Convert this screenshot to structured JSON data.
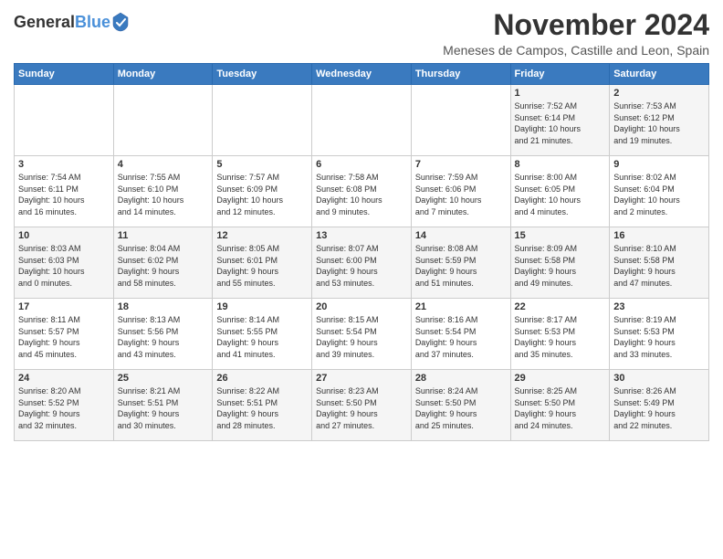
{
  "header": {
    "logo_line1": "General",
    "logo_line2": "Blue",
    "month": "November 2024",
    "location": "Meneses de Campos, Castille and Leon, Spain"
  },
  "weekdays": [
    "Sunday",
    "Monday",
    "Tuesday",
    "Wednesday",
    "Thursday",
    "Friday",
    "Saturday"
  ],
  "weeks": [
    [
      {
        "day": "",
        "info": ""
      },
      {
        "day": "",
        "info": ""
      },
      {
        "day": "",
        "info": ""
      },
      {
        "day": "",
        "info": ""
      },
      {
        "day": "",
        "info": ""
      },
      {
        "day": "1",
        "info": "Sunrise: 7:52 AM\nSunset: 6:14 PM\nDaylight: 10 hours\nand 21 minutes."
      },
      {
        "day": "2",
        "info": "Sunrise: 7:53 AM\nSunset: 6:12 PM\nDaylight: 10 hours\nand 19 minutes."
      }
    ],
    [
      {
        "day": "3",
        "info": "Sunrise: 7:54 AM\nSunset: 6:11 PM\nDaylight: 10 hours\nand 16 minutes."
      },
      {
        "day": "4",
        "info": "Sunrise: 7:55 AM\nSunset: 6:10 PM\nDaylight: 10 hours\nand 14 minutes."
      },
      {
        "day": "5",
        "info": "Sunrise: 7:57 AM\nSunset: 6:09 PM\nDaylight: 10 hours\nand 12 minutes."
      },
      {
        "day": "6",
        "info": "Sunrise: 7:58 AM\nSunset: 6:08 PM\nDaylight: 10 hours\nand 9 minutes."
      },
      {
        "day": "7",
        "info": "Sunrise: 7:59 AM\nSunset: 6:06 PM\nDaylight: 10 hours\nand 7 minutes."
      },
      {
        "day": "8",
        "info": "Sunrise: 8:00 AM\nSunset: 6:05 PM\nDaylight: 10 hours\nand 4 minutes."
      },
      {
        "day": "9",
        "info": "Sunrise: 8:02 AM\nSunset: 6:04 PM\nDaylight: 10 hours\nand 2 minutes."
      }
    ],
    [
      {
        "day": "10",
        "info": "Sunrise: 8:03 AM\nSunset: 6:03 PM\nDaylight: 10 hours\nand 0 minutes."
      },
      {
        "day": "11",
        "info": "Sunrise: 8:04 AM\nSunset: 6:02 PM\nDaylight: 9 hours\nand 58 minutes."
      },
      {
        "day": "12",
        "info": "Sunrise: 8:05 AM\nSunset: 6:01 PM\nDaylight: 9 hours\nand 55 minutes."
      },
      {
        "day": "13",
        "info": "Sunrise: 8:07 AM\nSunset: 6:00 PM\nDaylight: 9 hours\nand 53 minutes."
      },
      {
        "day": "14",
        "info": "Sunrise: 8:08 AM\nSunset: 5:59 PM\nDaylight: 9 hours\nand 51 minutes."
      },
      {
        "day": "15",
        "info": "Sunrise: 8:09 AM\nSunset: 5:58 PM\nDaylight: 9 hours\nand 49 minutes."
      },
      {
        "day": "16",
        "info": "Sunrise: 8:10 AM\nSunset: 5:58 PM\nDaylight: 9 hours\nand 47 minutes."
      }
    ],
    [
      {
        "day": "17",
        "info": "Sunrise: 8:11 AM\nSunset: 5:57 PM\nDaylight: 9 hours\nand 45 minutes."
      },
      {
        "day": "18",
        "info": "Sunrise: 8:13 AM\nSunset: 5:56 PM\nDaylight: 9 hours\nand 43 minutes."
      },
      {
        "day": "19",
        "info": "Sunrise: 8:14 AM\nSunset: 5:55 PM\nDaylight: 9 hours\nand 41 minutes."
      },
      {
        "day": "20",
        "info": "Sunrise: 8:15 AM\nSunset: 5:54 PM\nDaylight: 9 hours\nand 39 minutes."
      },
      {
        "day": "21",
        "info": "Sunrise: 8:16 AM\nSunset: 5:54 PM\nDaylight: 9 hours\nand 37 minutes."
      },
      {
        "day": "22",
        "info": "Sunrise: 8:17 AM\nSunset: 5:53 PM\nDaylight: 9 hours\nand 35 minutes."
      },
      {
        "day": "23",
        "info": "Sunrise: 8:19 AM\nSunset: 5:53 PM\nDaylight: 9 hours\nand 33 minutes."
      }
    ],
    [
      {
        "day": "24",
        "info": "Sunrise: 8:20 AM\nSunset: 5:52 PM\nDaylight: 9 hours\nand 32 minutes."
      },
      {
        "day": "25",
        "info": "Sunrise: 8:21 AM\nSunset: 5:51 PM\nDaylight: 9 hours\nand 30 minutes."
      },
      {
        "day": "26",
        "info": "Sunrise: 8:22 AM\nSunset: 5:51 PM\nDaylight: 9 hours\nand 28 minutes."
      },
      {
        "day": "27",
        "info": "Sunrise: 8:23 AM\nSunset: 5:50 PM\nDaylight: 9 hours\nand 27 minutes."
      },
      {
        "day": "28",
        "info": "Sunrise: 8:24 AM\nSunset: 5:50 PM\nDaylight: 9 hours\nand 25 minutes."
      },
      {
        "day": "29",
        "info": "Sunrise: 8:25 AM\nSunset: 5:50 PM\nDaylight: 9 hours\nand 24 minutes."
      },
      {
        "day": "30",
        "info": "Sunrise: 8:26 AM\nSunset: 5:49 PM\nDaylight: 9 hours\nand 22 minutes."
      }
    ]
  ]
}
